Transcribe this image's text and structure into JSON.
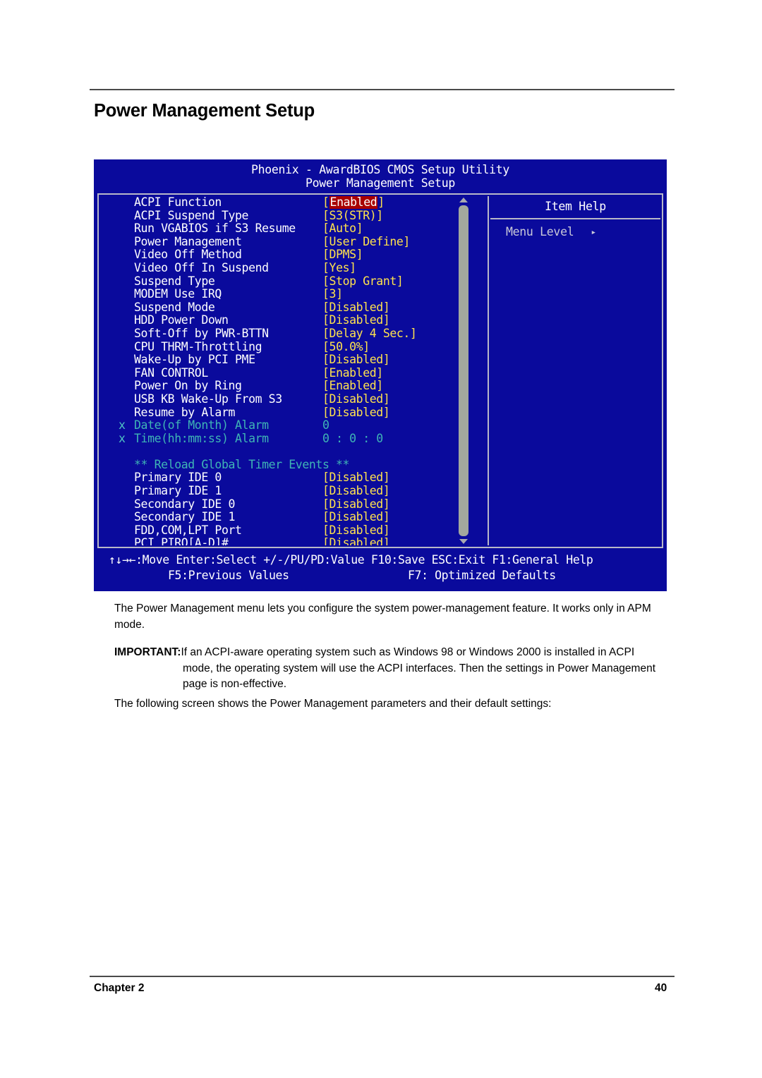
{
  "page": {
    "title": "Power Management Setup",
    "footer_left": "Chapter 2",
    "footer_right": "40"
  },
  "bios": {
    "title": "Phoenix - AwardBIOS CMOS Setup Utility",
    "subtitle": "Power Management Setup",
    "colors": {
      "background": "#0a0a9c",
      "label": "#ffffff",
      "value": "#ffe24d",
      "dimmed": "#3fb5b5",
      "highlight_bg": "#a80000",
      "highlight_fg": "#ffffff",
      "border": "#b8b8c8",
      "scrollbar_thumb": "#a3a89e"
    },
    "items": [
      {
        "mark": "",
        "label": "ACPI Function",
        "value": "Enabled",
        "bracket": true,
        "dim": false,
        "selected": true
      },
      {
        "mark": "",
        "label": "ACPI Suspend Type",
        "value": "S3(STR)",
        "bracket": true,
        "dim": false,
        "selected": false
      },
      {
        "mark": "",
        "label": "Run VGABIOS if S3 Resume",
        "value": "Auto",
        "bracket": true,
        "dim": false,
        "selected": false
      },
      {
        "mark": "",
        "label": "Power Management",
        "value": "User Define",
        "bracket": true,
        "dim": false,
        "selected": false
      },
      {
        "mark": "",
        "label": "Video Off Method",
        "value": "DPMS",
        "bracket": true,
        "dim": false,
        "selected": false
      },
      {
        "mark": "",
        "label": "Video Off In Suspend",
        "value": "Yes",
        "bracket": true,
        "dim": false,
        "selected": false
      },
      {
        "mark": "",
        "label": "Suspend Type",
        "value": "Stop Grant",
        "bracket": true,
        "dim": false,
        "selected": false
      },
      {
        "mark": "",
        "label": "MODEM Use IRQ",
        "value": "3",
        "bracket": true,
        "dim": false,
        "selected": false
      },
      {
        "mark": "",
        "label": "Suspend Mode",
        "value": "Disabled",
        "bracket": true,
        "dim": false,
        "selected": false
      },
      {
        "mark": "",
        "label": "HDD Power Down",
        "value": "Disabled",
        "bracket": true,
        "dim": false,
        "selected": false
      },
      {
        "mark": "",
        "label": "Soft-Off by PWR-BTTN",
        "value": "Delay 4 Sec.",
        "bracket": true,
        "dim": false,
        "selected": false
      },
      {
        "mark": "",
        "label": "CPU THRM-Throttling",
        "value": "50.0%",
        "bracket": true,
        "dim": false,
        "selected": false
      },
      {
        "mark": "",
        "label": "Wake-Up by PCI PME",
        "value": "Disabled",
        "bracket": true,
        "dim": false,
        "selected": false
      },
      {
        "mark": "",
        "label": "FAN CONTROL",
        "value": "Enabled",
        "bracket": true,
        "dim": false,
        "selected": false
      },
      {
        "mark": "",
        "label": "Power On by Ring",
        "value": "Enabled",
        "bracket": true,
        "dim": false,
        "selected": false
      },
      {
        "mark": "",
        "label": "USB KB Wake-Up From S3",
        "value": "Disabled",
        "bracket": true,
        "dim": false,
        "selected": false
      },
      {
        "mark": "",
        "label": "Resume by Alarm",
        "value": "Disabled",
        "bracket": true,
        "dim": false,
        "selected": false
      },
      {
        "mark": "x",
        "label": "Date(of Month) Alarm",
        "value": "0",
        "bracket": false,
        "dim": true,
        "selected": false
      },
      {
        "mark": "x",
        "label": "Time(hh:mm:ss) Alarm",
        "value": "0 :  0 :  0",
        "bracket": false,
        "dim": true,
        "selected": false
      },
      {
        "spacer": true
      },
      {
        "section": "** Reload Global Timer Events **"
      },
      {
        "mark": "",
        "label": "Primary IDE 0",
        "value": "Disabled",
        "bracket": true,
        "dim": false,
        "selected": false
      },
      {
        "mark": "",
        "label": "Primary IDE 1",
        "value": "Disabled",
        "bracket": true,
        "dim": false,
        "selected": false
      },
      {
        "mark": "",
        "label": "Secondary IDE 0",
        "value": "Disabled",
        "bracket": true,
        "dim": false,
        "selected": false
      },
      {
        "mark": "",
        "label": "Secondary IDE 1",
        "value": "Disabled",
        "bracket": true,
        "dim": false,
        "selected": false
      },
      {
        "mark": "",
        "label": "FDD,COM,LPT Port",
        "value": "Disabled",
        "bracket": true,
        "dim": false,
        "selected": false
      },
      {
        "mark": "",
        "label": "PCI PIRQ[A-D]#",
        "value": "Disabled",
        "bracket": true,
        "dim": false,
        "selected": false
      }
    ],
    "help": {
      "title": "Item Help",
      "menu_level_label": "Menu Level",
      "menu_level_arrow": "▸"
    },
    "scrollbar": {
      "up_arrow": "▲",
      "down_arrow": "▼"
    },
    "keybar": {
      "line1": "↑↓→←:Move   Enter:Select   +/-/PU/PD:Value   F10:Save   ESC:Exit   F1:General Help",
      "line2a": "F5:Previous Values",
      "line2b": "F7: Optimized Defaults"
    }
  },
  "prose": {
    "paragraph1": "The Power Management menu lets you configure the system power-management feature. It works only in APM mode.",
    "important_label": "IMPORTANT:",
    "important_text": "If an ACPI-aware operating system such as Windows 98 or Windows 2000 is installed in ACPI",
    "important_cont": "mode, the operating system will use the ACPI interfaces. Then the settings in Power Management page is non-effective.",
    "paragraph3": "The following screen shows the Power Management parameters and their default settings:"
  }
}
